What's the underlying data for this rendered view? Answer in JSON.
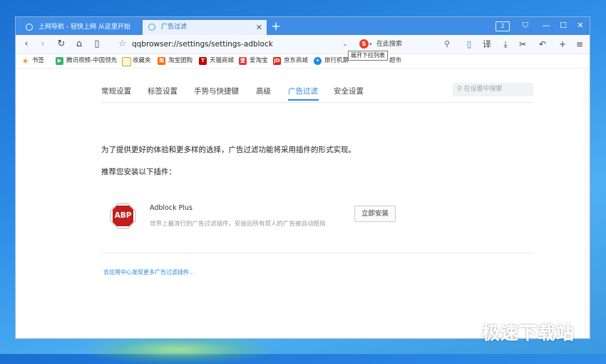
{
  "tabs": [
    {
      "label": "上网导航 - 轻快上网 从这里开始",
      "active": false
    },
    {
      "label": "广告过滤",
      "active": true
    }
  ],
  "tab_counter": "2",
  "address": {
    "url": "qqbrowser://settings/settings-adblock",
    "search_placeholder": "在此搜索",
    "tooltip": "展开下拉列表"
  },
  "toolbar": {
    "translate_label": "译"
  },
  "bookmarks": [
    {
      "label": "书签"
    },
    {
      "label": "腾讯视频-中国领先"
    },
    {
      "label": "收藏夹"
    },
    {
      "label": "淘宝团购"
    },
    {
      "label": "天猫商城"
    },
    {
      "label": "爱淘宝"
    },
    {
      "label": "京东商城"
    },
    {
      "label": "旅行机票"
    },
    {
      "label": "超市"
    }
  ],
  "settings": {
    "nav": [
      {
        "label": "常规设置"
      },
      {
        "label": "标签设置"
      },
      {
        "label": "手势与快捷键"
      },
      {
        "label": "高级"
      },
      {
        "label": "广告过滤",
        "active": true
      },
      {
        "label": "安全设置"
      }
    ],
    "search_placeholder": "在设置中搜索",
    "intro": "为了提供更好的体验和更多样的选择，广告过滤功能将采用插件的形式实现。",
    "recommend": "推荐您安装以下插件：",
    "plugin": {
      "logo_text": "ABP",
      "name": "Adblock Plus",
      "description": "世界上最流行的广告过滤插件，安装后所有烦人的广告被自动阻挡",
      "install_label": "立即安装"
    },
    "more_link": "去应用中心发现更多广告过滤插件..."
  },
  "watermark": "极速下载站",
  "colors": {
    "tabbar": "#3f8de6",
    "accent": "#2b86e0",
    "abp_red": "#c41d1d"
  }
}
